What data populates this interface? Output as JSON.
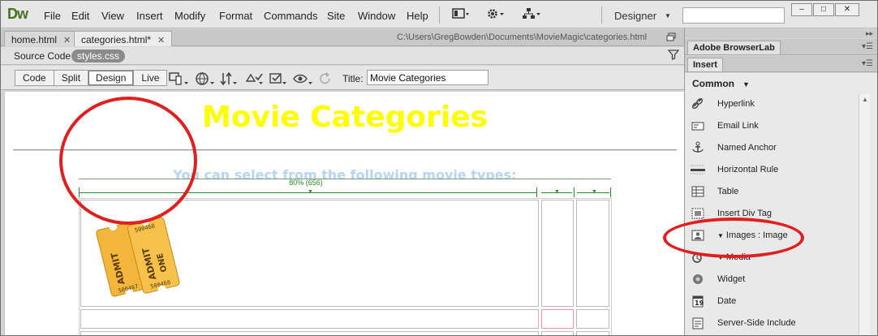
{
  "app": {
    "logo": "Dw"
  },
  "menu": [
    "File",
    "Edit",
    "View",
    "Insert",
    "Modify",
    "Format",
    "Commands",
    "Site",
    "Window",
    "Help"
  ],
  "workspace": {
    "label": "Designer"
  },
  "window_buttons": {
    "minimize": "–",
    "restore": "□",
    "close": "✕"
  },
  "tabs": [
    {
      "label": "home.html",
      "close": "✕"
    },
    {
      "label": "categories.html*",
      "close": "✕"
    }
  ],
  "doc_path": "C:\\Users\\GregBowden\\Documents\\MovieMagic\\categories.html",
  "related_files": {
    "source": "Source Code",
    "css": "styles.css"
  },
  "view_buttons": {
    "code": "Code",
    "split": "Split",
    "design": "Design",
    "live": "Live",
    "active": "Design"
  },
  "title_field": {
    "label": "Title:",
    "value": "Movie Categories"
  },
  "page": {
    "heading": "Movie Categories",
    "subheading": "You can select from the following movie types:",
    "width_label": "80% (656)",
    "ticket_text_admit": "ADMIT",
    "ticket_text_one": "ONE",
    "ticket_numbers": [
      "500468",
      "500467",
      "500468"
    ]
  },
  "right_panel": {
    "top_arrows": "▸▸",
    "browserlab_tab": "Adobe BrowserLab",
    "insert_tab": "Insert",
    "category": "Common",
    "items": [
      {
        "label": "Hyperlink",
        "icon": "hyperlink-icon"
      },
      {
        "label": "Email Link",
        "icon": "email-link-icon"
      },
      {
        "label": "Named Anchor",
        "icon": "named-anchor-icon"
      },
      {
        "label": "Horizontal Rule",
        "icon": "horizontal-rule-icon"
      },
      {
        "label": "Table",
        "icon": "table-icon"
      },
      {
        "label": "Insert Div Tag",
        "icon": "div-tag-icon"
      },
      {
        "label": "Images : Image",
        "icon": "image-icon"
      },
      {
        "label": "Media",
        "icon": "media-icon"
      },
      {
        "label": "Widget",
        "icon": "widget-icon"
      },
      {
        "label": "Date",
        "icon": "date-icon"
      },
      {
        "label": "Server-Side Include",
        "icon": "server-side-include-icon"
      }
    ]
  },
  "colors": {
    "heading": "#ffff00",
    "subheading": "#b6d5f0",
    "annotation": "#e02020",
    "logo": "#47721f"
  }
}
